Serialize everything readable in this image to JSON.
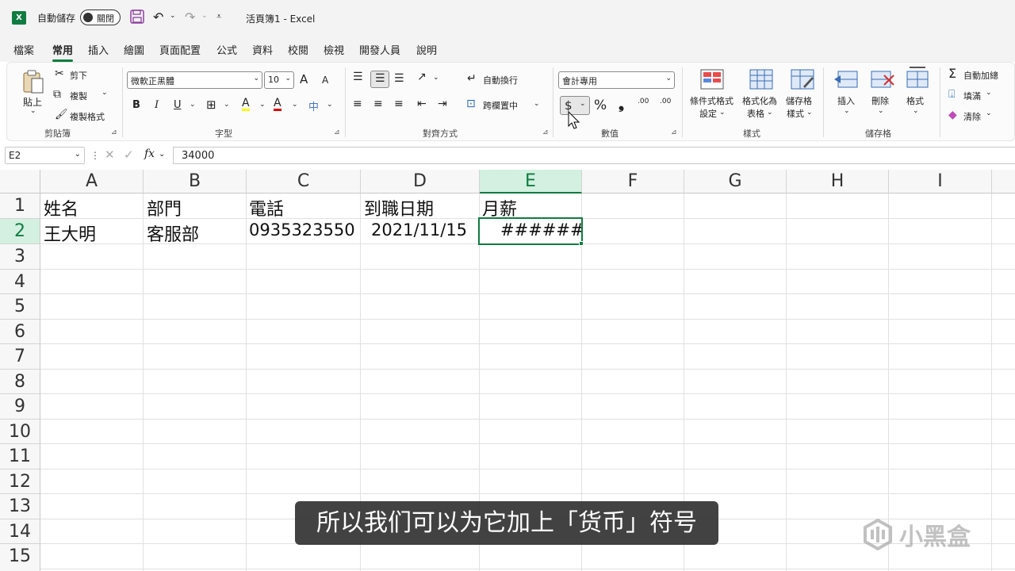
{
  "titlebar": {
    "app_logo": "X",
    "autosave_label": "自動儲存",
    "autosave_state": "關閉",
    "doc_title": "活頁簿1 - Excel"
  },
  "menu": {
    "tabs": [
      "檔案",
      "常用",
      "插入",
      "繪圖",
      "頁面配置",
      "公式",
      "資料",
      "校閱",
      "檢視",
      "開發人員",
      "說明"
    ],
    "active": "常用"
  },
  "ribbon": {
    "clipboard": {
      "paste": "貼上",
      "cut": "剪下",
      "copy": "複製",
      "format_painter": "複製格式",
      "group": "剪貼簿"
    },
    "font": {
      "name": "微軟正黑體",
      "size": "10",
      "grow": "A",
      "shrink": "A",
      "bold": "B",
      "italic": "I",
      "underline": "U",
      "fill_color_icon": "A",
      "font_color_icon": "A",
      "group": "字型"
    },
    "alignment": {
      "wrap_text": "自動換行",
      "merge_center": "跨欄置中",
      "group": "對齊方式"
    },
    "number": {
      "format": "會計專用",
      "currency": "$",
      "percent": "%",
      "comma": "❟",
      "inc_decimal": ".00",
      "dec_decimal": ".00",
      "group": "數值"
    },
    "styles": {
      "conditional_1": "條件式格式",
      "conditional_2": "設定",
      "table_1": "格式化為",
      "table_2": "表格",
      "cell_styles_1": "儲存格",
      "cell_styles_2": "樣式",
      "group": "樣式"
    },
    "cells": {
      "insert": "插入",
      "delete": "刪除",
      "format": "格式",
      "group": "儲存格"
    },
    "editing": {
      "autosum": "自動加總",
      "fill": "填滿",
      "clear": "清除"
    }
  },
  "formula_bar": {
    "name_box": "E2",
    "fx": "fx",
    "value": "34000"
  },
  "sheet": {
    "columns": [
      "A",
      "B",
      "C",
      "D",
      "E",
      "F",
      "G",
      "H",
      "I"
    ],
    "rows": [
      "1",
      "2",
      "3",
      "4",
      "5",
      "6",
      "7",
      "8",
      "9",
      "10",
      "11",
      "12",
      "13",
      "14",
      "15"
    ],
    "selected_column": "E",
    "selected_row": "2",
    "cells": {
      "A1": "姓名",
      "B1": "部門",
      "C1": "電話",
      "D1": "到職日期",
      "E1": "月薪",
      "A2": "王大明",
      "B2": "客服部",
      "C2": "0935323550",
      "D2": "2021/11/15",
      "E2": "######"
    }
  },
  "overlay": {
    "subtitle": "所以我们可以为它加上「货币」符号",
    "watermark": "小黑盒"
  },
  "colors": {
    "accent": "#107c41",
    "selected_header_bg": "#d3f0e0"
  }
}
